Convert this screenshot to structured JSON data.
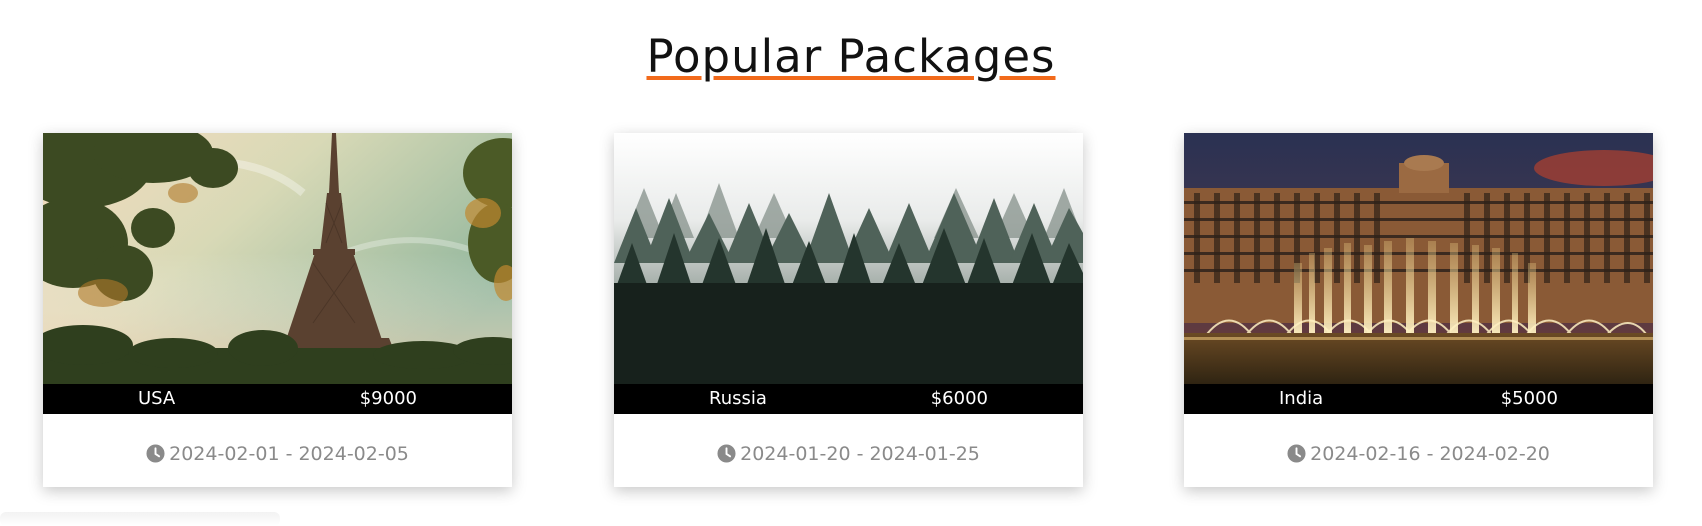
{
  "section": {
    "title": "Popular Packages"
  },
  "packages": [
    {
      "country": "USA",
      "price": "$9000",
      "dates": "2024-02-01 - 2024-02-05",
      "image": "eiffel-tower-photo"
    },
    {
      "country": "Russia",
      "price": "$6000",
      "dates": "2024-01-20 - 2024-01-25",
      "image": "misty-forest-photo"
    },
    {
      "country": "India",
      "price": "$5000",
      "dates": "2024-02-16 - 2024-02-20",
      "image": "hotel-fountain-photo"
    }
  ],
  "colors": {
    "accent": "#f26a1b",
    "caption_bar": "#000000",
    "date_text": "#8a8a8a"
  },
  "icons": {
    "dates": "clock-icon"
  }
}
